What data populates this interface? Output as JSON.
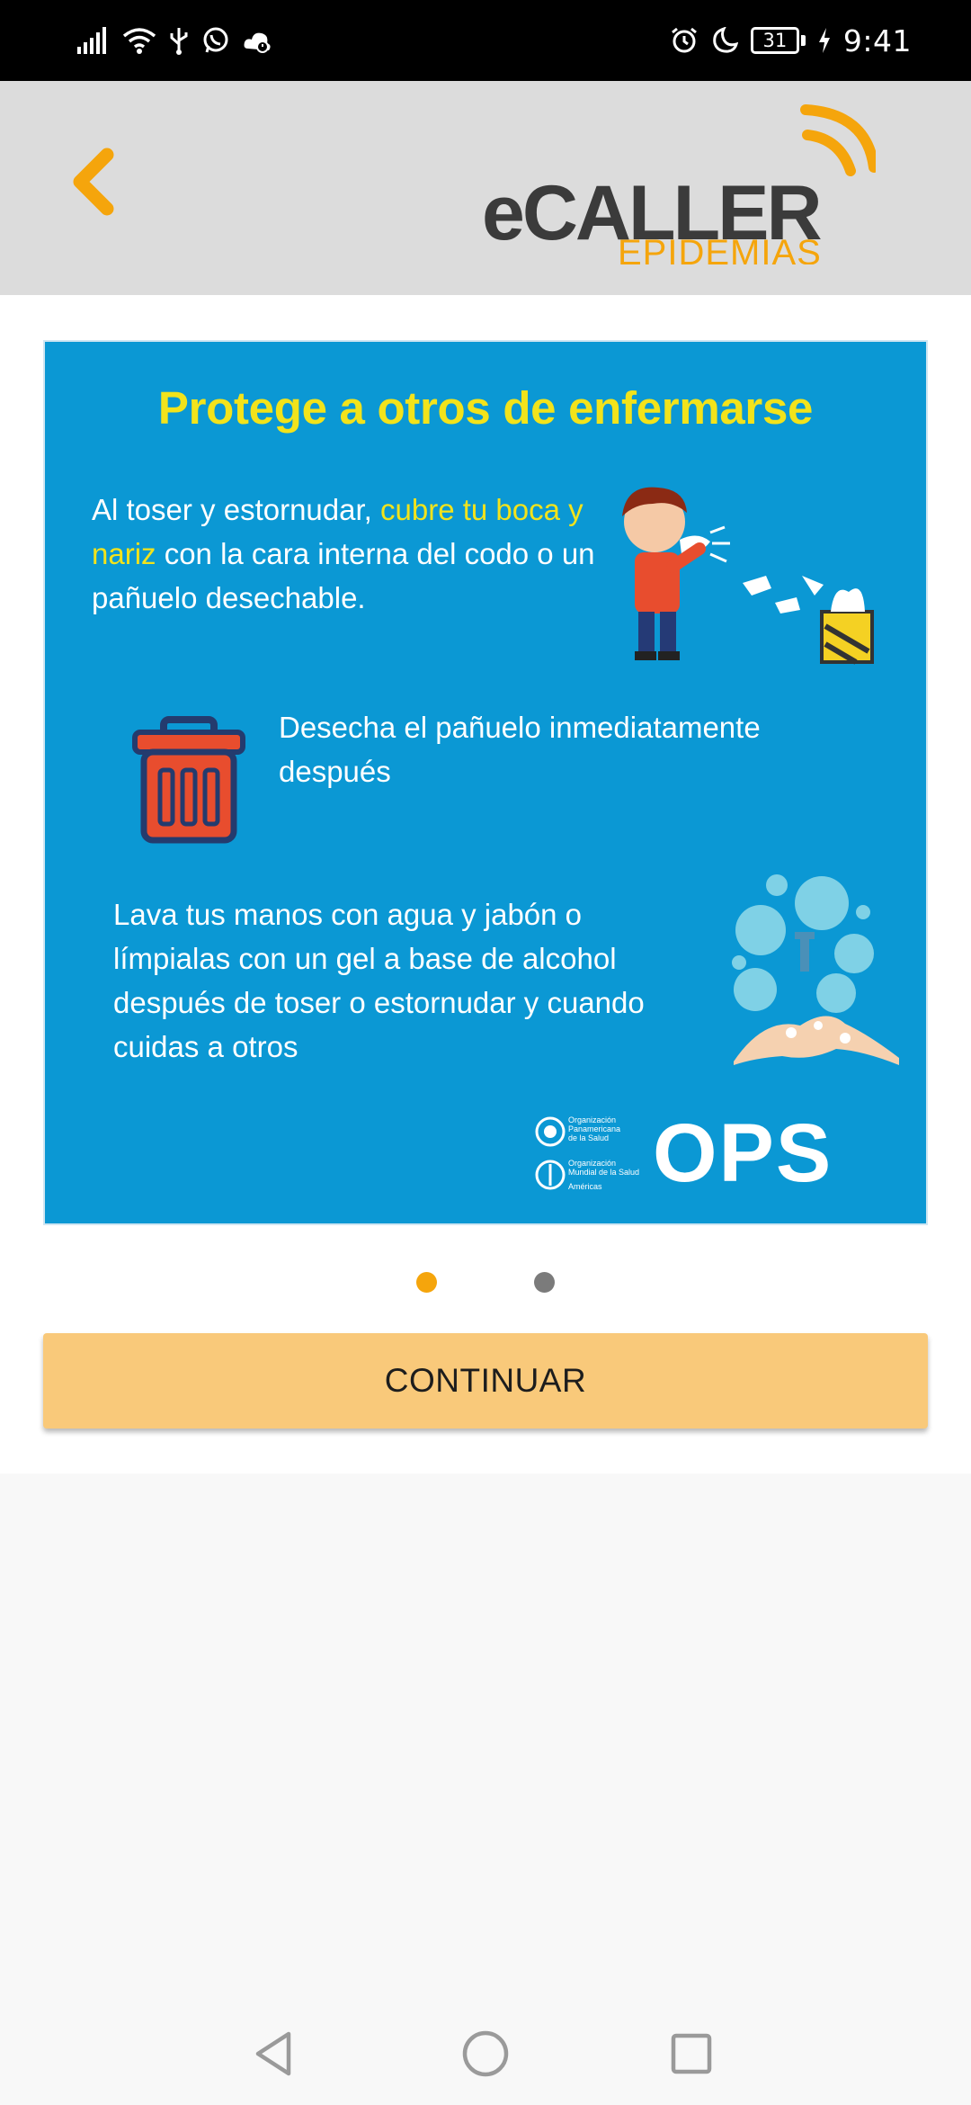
{
  "status_bar": {
    "time": "9:41",
    "battery_level": "31",
    "left_icons": [
      "signal-icon",
      "wifi-icon",
      "usb-icon",
      "whatsapp-icon",
      "weather-icon"
    ],
    "right_icons": [
      "alarm-icon",
      "moon-icon",
      "battery-icon",
      "charging-icon"
    ]
  },
  "header": {
    "back_icon": "chevron-left-icon",
    "logo": {
      "brand": "eCALLER",
      "subtitle": "EPIDEMIAS"
    }
  },
  "card": {
    "title": "Protege a otros de enfermarse",
    "item1": {
      "text_a": "Al toser y estornudar, ",
      "highlight": "cubre tu boca y nariz",
      "text_b": " con la cara interna del codo o un pañuelo desechable."
    },
    "item2": "Desecha el pañuelo inmediatamente después",
    "item3": "Lava tus manos con agua y jabón o límpialas con un gel a base de alcohol después de toser o estornudar y cuando cuidas a otros",
    "org": {
      "line1": "Organización",
      "line2": "Panamericana",
      "line3": "de la Salud",
      "line4": "Organización",
      "line5": "Mundial de la Salud",
      "line6": "Américas",
      "acronym": "OPS"
    }
  },
  "pager": {
    "total": 2,
    "active": 1
  },
  "actions": {
    "continue_label": "CONTINUAR"
  },
  "colors": {
    "accent": "#F5A50C",
    "card_bg": "#0B98D4",
    "highlight_text": "#F2E31B",
    "button_bg": "#F9C97A",
    "header_bg": "#DCDCDC"
  },
  "nav_bar": {
    "icons": [
      "back-triangle-icon",
      "home-circle-icon",
      "recents-square-icon"
    ]
  }
}
